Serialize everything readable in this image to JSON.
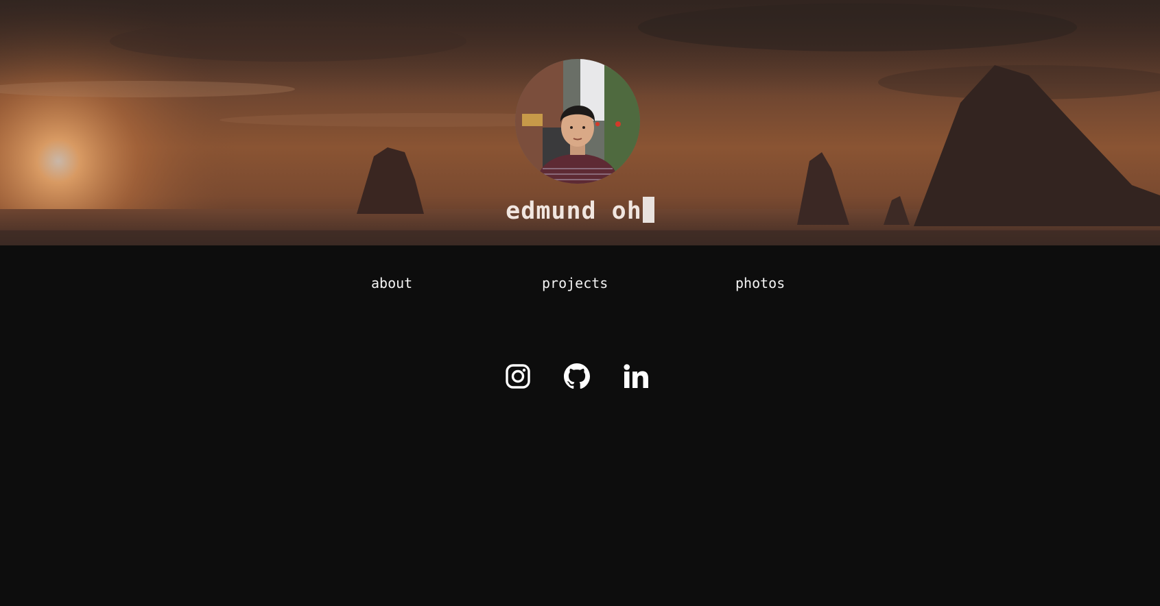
{
  "header": {
    "title": "edmund oh"
  },
  "nav": {
    "items": [
      {
        "label": "about"
      },
      {
        "label": "projects"
      },
      {
        "label": "photos"
      }
    ]
  },
  "social": {
    "icons": [
      "instagram-icon",
      "github-icon",
      "linkedin-icon"
    ]
  },
  "colors": {
    "page_background": "#0d0d0d",
    "text": "#f2f2f2",
    "hero_tone": "#8a5433"
  }
}
